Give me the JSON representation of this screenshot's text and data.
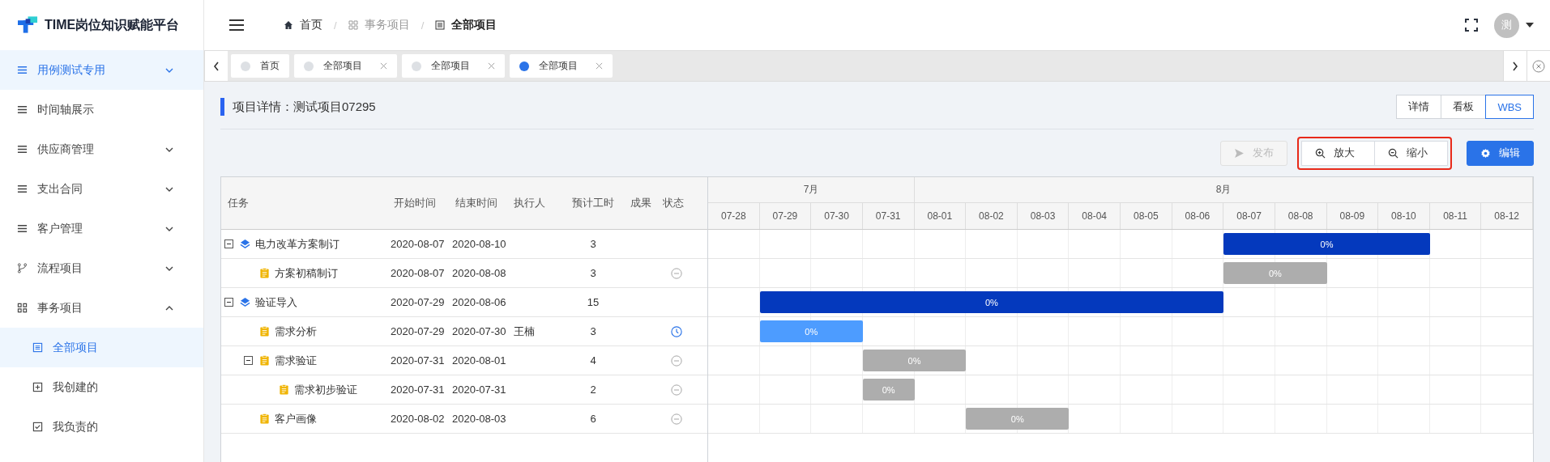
{
  "app": {
    "title": "TIME岗位知识赋能平台"
  },
  "sidebar": {
    "items": [
      {
        "label": "用例测试专用",
        "kind": "list",
        "selected": true,
        "expanded": false
      },
      {
        "label": "时间轴展示",
        "kind": "list",
        "selected": false
      },
      {
        "label": "供应商管理",
        "kind": "list",
        "selected": false,
        "expanded": false
      },
      {
        "label": "支出合同",
        "kind": "list",
        "selected": false,
        "expanded": false
      },
      {
        "label": "客户管理",
        "kind": "list",
        "selected": false,
        "expanded": false
      },
      {
        "label": "流程项目",
        "kind": "branch",
        "selected": false,
        "expanded": false
      },
      {
        "label": "事务项目",
        "kind": "grid",
        "selected": false,
        "expanded": true,
        "children": [
          {
            "label": "全部项目",
            "kind": "doc",
            "selected": true
          },
          {
            "label": "我创建的",
            "kind": "plus",
            "selected": false
          },
          {
            "label": "我负责的",
            "kind": "check",
            "selected": false
          }
        ]
      }
    ]
  },
  "breadcrumb": [
    {
      "label": "首页",
      "kind": "home"
    },
    {
      "separator": "/",
      "label": "事务项目",
      "kind": "grid"
    },
    {
      "separator": "/",
      "label": "全部项目",
      "kind": "doc"
    }
  ],
  "user": {
    "avatar": "测"
  },
  "tabs": [
    {
      "label": "首页",
      "selected": false,
      "closable": false
    },
    {
      "label": "全部项目",
      "selected": false,
      "closable": true
    },
    {
      "label": "全部项目",
      "selected": false,
      "closable": true
    },
    {
      "label": "全部项目",
      "selected": true,
      "closable": true
    }
  ],
  "page": {
    "title": "项目详情：测试项目07295"
  },
  "views": [
    {
      "label": "详情",
      "selected": false
    },
    {
      "label": "看板",
      "selected": false
    },
    {
      "label": "WBS",
      "selected": true
    }
  ],
  "actions": {
    "publish": {
      "label": "发布",
      "disabled": true
    },
    "zoom_in": "放大",
    "zoom_out": "缩小",
    "edit": "编辑"
  },
  "table": {
    "columns": [
      "任务",
      "开始时间",
      "结束时间",
      "执行人",
      "预计工时",
      "成果",
      "状态"
    ],
    "rows": [
      {
        "name": "电力改革方案制订",
        "kind": "group",
        "expanded": true,
        "start": "2020-08-07",
        "end": "2020-08-10",
        "hours": "3",
        "progress": "0%",
        "children": [
          {
            "name": "方案初稿制订",
            "kind": "pending",
            "start": "2020-08-07",
            "end": "2020-08-08",
            "hours": "3",
            "progress": "0%"
          }
        ]
      },
      {
        "name": "验证导入",
        "kind": "group",
        "expanded": true,
        "start": "2020-07-29",
        "end": "2020-08-06",
        "hours": "15",
        "progress": "0%",
        "children": [
          {
            "name": "需求分析",
            "kind": "active",
            "start": "2020-07-29",
            "end": "2020-07-30",
            "owner": "王楠",
            "hours": "3",
            "progress": "0%"
          },
          {
            "name": "需求验证",
            "kind": "pending",
            "expanded": true,
            "start": "2020-07-31",
            "end": "2020-08-01",
            "hours": "4",
            "progress": "0%",
            "children": [
              {
                "name": "需求初步验证",
                "kind": "pending",
                "start": "2020-07-31",
                "end": "2020-07-31",
                "hours": "2",
                "progress": "0%"
              }
            ]
          },
          {
            "name": "客户画像",
            "kind": "pending",
            "start": "2020-08-02",
            "end": "2020-08-03",
            "hours": "6",
            "progress": "0%"
          }
        ]
      }
    ]
  },
  "gantt": {
    "months": [
      "7月",
      "8月"
    ],
    "days": [
      "07-28",
      "07-29",
      "07-30",
      "07-31",
      "08-01",
      "08-02",
      "08-03",
      "08-04",
      "08-05",
      "08-06",
      "08-07",
      "08-08",
      "08-09",
      "08-10",
      "08-11",
      "08-12"
    ]
  }
}
